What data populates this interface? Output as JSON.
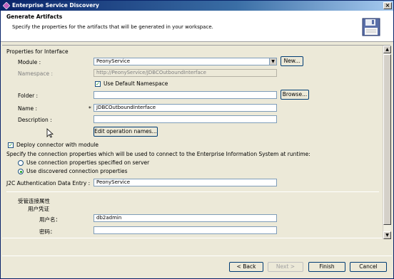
{
  "window": {
    "title": "Enterprise Service Discovery",
    "close_glyph": "×"
  },
  "header": {
    "title": "Generate Artifacts",
    "description": "Specify the properties for the artifacts that will be generated in your workspace."
  },
  "interface": {
    "section_title": "Properties for Interface",
    "module_label": "Module :",
    "module_value": "PeonyService",
    "new_button": "New...",
    "namespace_label": "Namespace :",
    "namespace_value": "http://PeonyService/JDBCOutboundInterface",
    "use_default_namespace": "Use Default Namespace",
    "folder_label": "Folder :",
    "folder_value": "",
    "browse_button": "Browse...",
    "name_label": "Name :",
    "name_required": "*",
    "name_value": "JDBCOutboundInterface",
    "description_label": "Description :",
    "description_value": "",
    "edit_ops_button": "Edit operation names..."
  },
  "connector": {
    "deploy_label": "Deploy connector with module",
    "specify_text": "Specify the connection properties which will be used to connect to the Enterprise Information System at runtime:",
    "radio_server": "Use connection properties specified on server",
    "radio_discovered": "Use discovered connection properties",
    "j2c_label": "J2C Authentication Data Entry :",
    "j2c_value": "PeonyService"
  },
  "managed": {
    "section_title": "受管连接属性",
    "credential_title": "用户凭证",
    "username_label": "用户名：",
    "username_value": "db2admin",
    "password_label": "密码：",
    "password_value": ""
  },
  "footer": {
    "back": "< Back",
    "next": "Next >",
    "finish": "Finish",
    "cancel": "Cancel"
  },
  "colors": {
    "title_start": "#0a246a",
    "title_end": "#a6caf0",
    "check_green": "#21a121"
  }
}
